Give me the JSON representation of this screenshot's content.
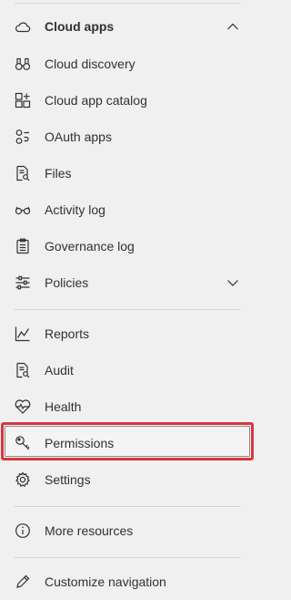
{
  "nav": {
    "cloud_apps": {
      "label": "Cloud apps",
      "icon": "cloud-icon",
      "expanded": true
    },
    "items": [
      {
        "id": "cloud-discovery",
        "label": "Cloud discovery",
        "icon": "binoculars-icon"
      },
      {
        "id": "cloud-app-catalog",
        "label": "Cloud app catalog",
        "icon": "catalog-grid-icon"
      },
      {
        "id": "oauth-apps",
        "label": "OAuth apps",
        "icon": "oauth-apps-icon"
      },
      {
        "id": "files",
        "label": "Files",
        "icon": "file-search-icon"
      },
      {
        "id": "activity-log",
        "label": "Activity log",
        "icon": "glasses-icon"
      },
      {
        "id": "governance-log",
        "label": "Governance log",
        "icon": "clipboard-icon"
      },
      {
        "id": "policies",
        "label": "Policies",
        "icon": "sliders-icon",
        "expandable": true
      }
    ],
    "section2": [
      {
        "id": "reports",
        "label": "Reports",
        "icon": "line-chart-icon"
      },
      {
        "id": "audit",
        "label": "Audit",
        "icon": "audit-icon"
      },
      {
        "id": "health",
        "label": "Health",
        "icon": "heart-pulse-icon"
      },
      {
        "id": "permissions",
        "label": "Permissions",
        "icon": "key-icon",
        "highlighted": true
      },
      {
        "id": "settings",
        "label": "Settings",
        "icon": "gear-icon"
      }
    ],
    "more_resources": {
      "label": "More resources",
      "icon": "info-icon"
    },
    "customize": {
      "label": "Customize navigation",
      "icon": "pencil-icon"
    }
  },
  "colors": {
    "highlight_border": "#d9363e",
    "background": "#f0f0f0",
    "text": "#323130"
  }
}
